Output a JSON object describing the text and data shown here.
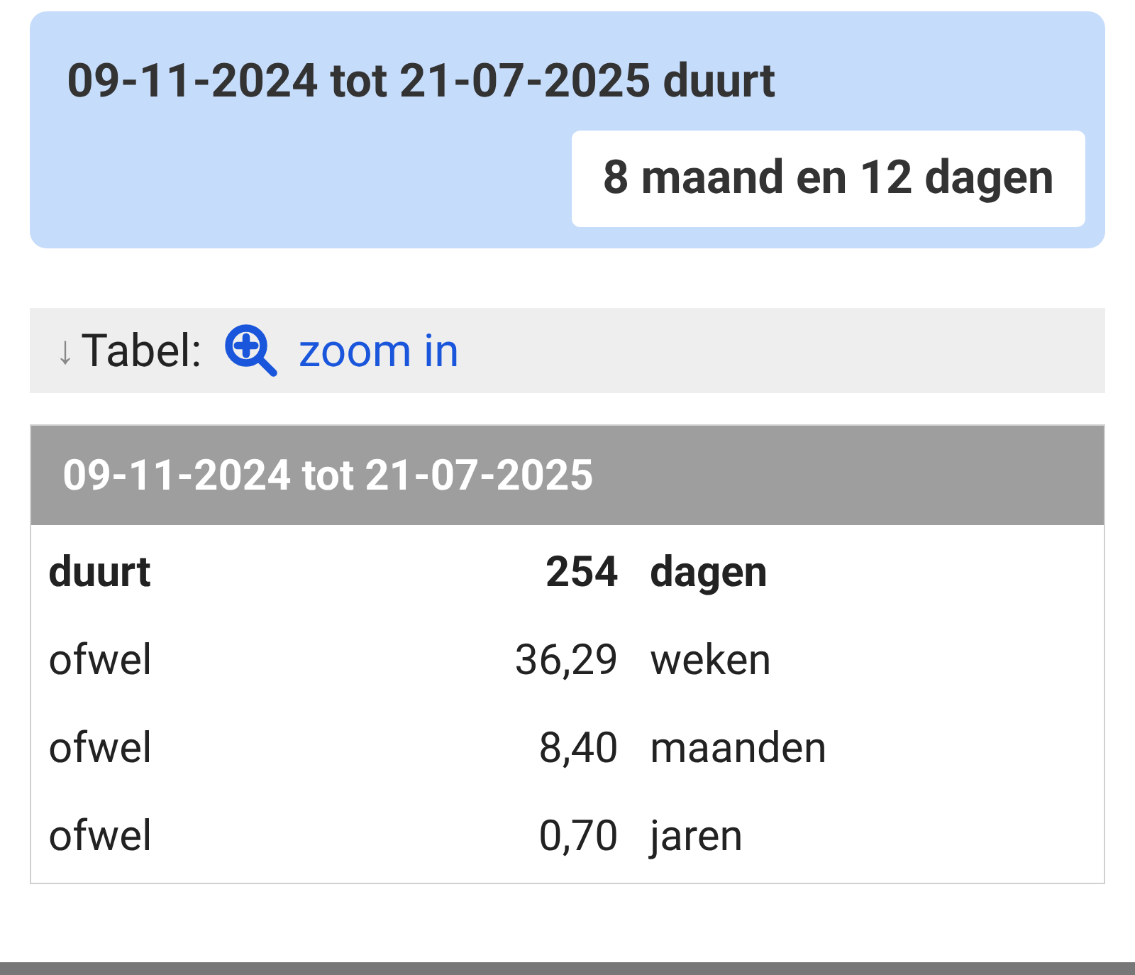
{
  "result_card": {
    "title": "09-11-2024 tot 21-07-2025 duurt",
    "result": "8 maand en 12 dagen"
  },
  "table_bar": {
    "arrow": "↓",
    "label": "Tabel:",
    "link": "zoom in"
  },
  "table": {
    "header": "09-11-2024 tot 21-07-2025",
    "rows": [
      {
        "label": "duurt",
        "value": "254",
        "unit": "dagen",
        "bold": true
      },
      {
        "label": "ofwel",
        "value": "36,29",
        "unit": "weken",
        "bold": false
      },
      {
        "label": "ofwel",
        "value": "8,40",
        "unit": "maanden",
        "bold": false
      },
      {
        "label": "ofwel",
        "value": "0,70",
        "unit": "jaren",
        "bold": false
      }
    ]
  }
}
